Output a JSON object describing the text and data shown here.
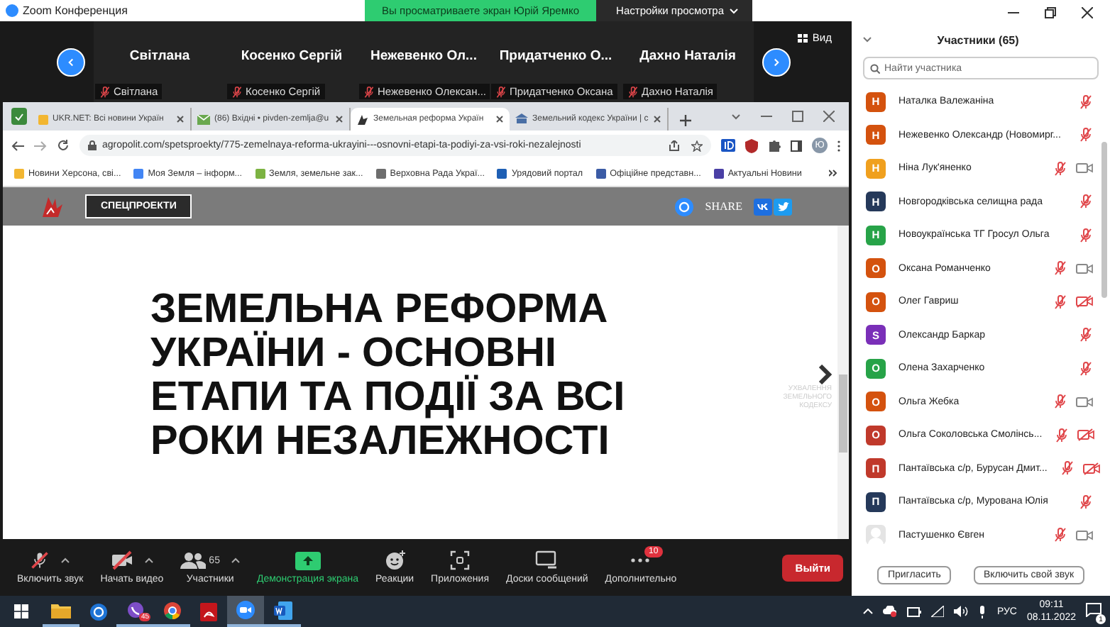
{
  "window": {
    "title": "Zoom Конференция"
  },
  "share_banner": {
    "text": "Вы просматриваете экран Юрій Яремко",
    "settings": "Настройки просмотра"
  },
  "gallery": {
    "view_label": "Вид",
    "tiles": [
      {
        "name": "Світлана",
        "label": "Світлана",
        "muted": true
      },
      {
        "name": "Косенко Сергій",
        "label": "Косенко Сергій",
        "muted": true
      },
      {
        "name": "Нежевенко  Ол...",
        "label": "Нежевенко Олексан...",
        "muted": true
      },
      {
        "name": "Придатченко  О...",
        "label": "Придатченко Оксана",
        "muted": true
      },
      {
        "name": "Дахно Наталія",
        "label": "Дахно Наталія",
        "muted": true
      }
    ]
  },
  "browser": {
    "tabs": [
      {
        "title": "UKR.NET: Всі новини Україн",
        "kind": "news",
        "selected": false
      },
      {
        "title": "(86) Вхідні • pivden-zemlja@u",
        "kind": "mail",
        "selected": false
      },
      {
        "title": "Земельная реформа Україн",
        "kind": "site",
        "selected": true
      },
      {
        "title": "Земельний кодекс України | с",
        "kind": "gov",
        "selected": false
      }
    ],
    "url": "agropolit.com/spetsproekty/775-zemelnaya-reforma-ukrayini---osnovni-etapi-ta-podiyi-za-vsi-roki-nezalejnosti",
    "profile_letter": "Ю",
    "bookmarks": [
      {
        "label": "Новини Херсона, сві...",
        "kind": "sun"
      },
      {
        "label": "Моя Земля – інформ...",
        "kind": "squares"
      },
      {
        "label": "Земля, земельне зак...",
        "kind": "field"
      },
      {
        "label": "Верховна Рада Украї...",
        "kind": "building"
      },
      {
        "label": "Урядовий портал",
        "kind": "flag"
      },
      {
        "label": "Офіційне представн...",
        "kind": "trident"
      },
      {
        "label": "Актуальні Новини",
        "kind": "dots"
      }
    ]
  },
  "page": {
    "menu_button": "СПЕЦПРОЕКТИ",
    "share_label": "SHARE",
    "headline": "ЗЕМЕЛЬНА РЕФОРМА УКРАЇНИ - ОСНОВНІ ЕТАПИ ТА ПОДІЇ ЗА ВСІ РОКИ НЕЗАЛЕЖНОСТІ",
    "next_label": "УХВАЛЕННЯ ЗЕМЕЛЬНОГО КОДЕКСУ"
  },
  "toolbar": {
    "items": [
      {
        "kind": "mic",
        "label": "Включить звук",
        "crossed": true
      },
      {
        "kind": "video",
        "label": "Начать видео",
        "crossed": true
      },
      {
        "kind": "participants",
        "label": "Участники",
        "count": "65"
      },
      {
        "kind": "share",
        "label": "Демонстрация экрана"
      },
      {
        "kind": "reactions",
        "label": "Реакции"
      },
      {
        "kind": "apps",
        "label": "Приложения"
      },
      {
        "kind": "whiteboards",
        "label": "Доски сообщений"
      },
      {
        "kind": "more",
        "label": "Дополнительно",
        "badge": "10"
      }
    ],
    "leave": "Выйти"
  },
  "participants": {
    "title": "Участники (65)",
    "search_placeholder": "Найти участника",
    "items": [
      {
        "name": "Наталка Валежаніна",
        "kind": "letter",
        "letter": "Н",
        "color": "#d4520e",
        "muted": true
      },
      {
        "name": "Нежевенко Олександр (Новомирг...",
        "kind": "letter",
        "letter": "Н",
        "color": "#d4520e",
        "muted": true
      },
      {
        "name": "Ніна Лук'яненко",
        "kind": "letter",
        "letter": "Н",
        "color": "#f0a01e",
        "muted": true,
        "video_off": false
      },
      {
        "name": "Новгородківська селищна рада",
        "kind": "letter",
        "letter": "Н",
        "color": "#25395a",
        "muted": true
      },
      {
        "name": "Новоукраїнська ТГ Гросул Ольга",
        "kind": "letter",
        "letter": "Н",
        "color": "#27a348",
        "muted": true
      },
      {
        "name": "Оксана Романченко",
        "kind": "letter",
        "letter": "О",
        "color": "#d4520e",
        "muted": true,
        "video_off": false
      },
      {
        "name": "Олег Гавриш",
        "kind": "letter",
        "letter": "О",
        "color": "#d4520e",
        "muted": true,
        "video_off": true
      },
      {
        "name": "Олександр Баркар",
        "kind": "letter",
        "letter": "S",
        "color": "#7a2fb8",
        "muted": true
      },
      {
        "name": "Олена Захарченко",
        "kind": "letter",
        "letter": "О",
        "color": "#27a348",
        "muted": true
      },
      {
        "name": "Ольга Жебка",
        "kind": "letter",
        "letter": "О",
        "color": "#d4520e",
        "muted": true,
        "video_off": false
      },
      {
        "name": "Ольга Соколовська Смолінсь...",
        "kind": "letter",
        "letter": "О",
        "color": "#c0392b",
        "muted": true,
        "video_off": true
      },
      {
        "name": "Пантаївська с/р, Бурусан Дмит...",
        "kind": "letter",
        "letter": "П",
        "color": "#c0392b",
        "muted": true,
        "video_off": true
      },
      {
        "name": "Пантаївська с/р, Мурована Юлія",
        "kind": "letter",
        "letter": "П",
        "color": "#25395a",
        "muted": true
      },
      {
        "name": "Пастушенко Євген",
        "kind": "silhouette",
        "muted": true,
        "video_off": false
      }
    ],
    "buttons": [
      "Пригласить",
      "Включить свой звук"
    ]
  },
  "taskbar": {
    "apps": [
      {
        "kind": "folder",
        "running": true,
        "selected": false
      },
      {
        "kind": "edge",
        "running": false,
        "selected": false
      },
      {
        "kind": "viber",
        "badge": "45",
        "running": true,
        "selected": false
      },
      {
        "kind": "chrome",
        "running": true,
        "selected": false
      },
      {
        "kind": "acrobat",
        "running": false,
        "selected": false
      },
      {
        "kind": "zoom",
        "running": true,
        "selected": true
      },
      {
        "kind": "word",
        "running": true,
        "selected": false
      }
    ],
    "language": "РУС",
    "time": "09:11",
    "date": "08.11.2022",
    "notifications": "1"
  }
}
